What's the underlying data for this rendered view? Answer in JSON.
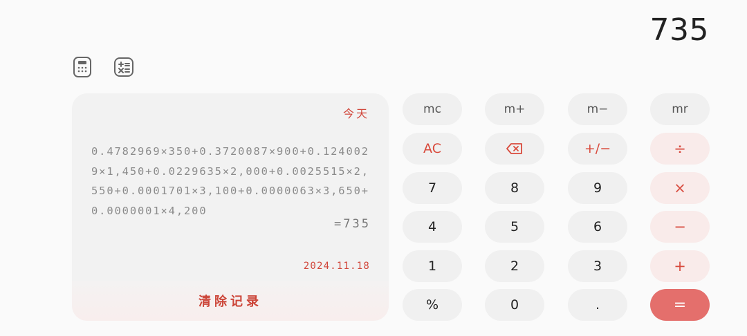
{
  "display": {
    "value": "735"
  },
  "toolbar": {
    "icons": [
      "calculator-icon",
      "math-operations-icon"
    ]
  },
  "history": {
    "today_label": "今天",
    "expression": "0.4782969×350+0.3720087×900+0.1240029×1,450+0.0229635×2,000+0.0025515×2,550+0.0001701×3,100+0.0000063×3,650+0.0000001×4,200",
    "result": "=735",
    "date": "2024.11.18",
    "clear_label": "清除记录"
  },
  "keys": {
    "mc": "mc",
    "m_plus": "m+",
    "m_minus": "m−",
    "mr": "mr",
    "ac": "AC",
    "backspace": "backspace-icon",
    "plus_minus": "+/−",
    "divide": "÷",
    "seven": "7",
    "eight": "8",
    "nine": "9",
    "multiply": "×",
    "four": "4",
    "five": "5",
    "six": "6",
    "minus": "−",
    "one": "1",
    "two": "2",
    "three": "3",
    "plus": "+",
    "percent": "%",
    "zero": "0",
    "decimal": ".",
    "equals": "="
  },
  "colors": {
    "accent": "#d84a3d",
    "equals_bg": "#e46f6c",
    "operator_bg": "#f9ebea",
    "key_bg": "#f0f0f0",
    "history_bg": "#f2f2f2",
    "background": "#fafafa"
  }
}
